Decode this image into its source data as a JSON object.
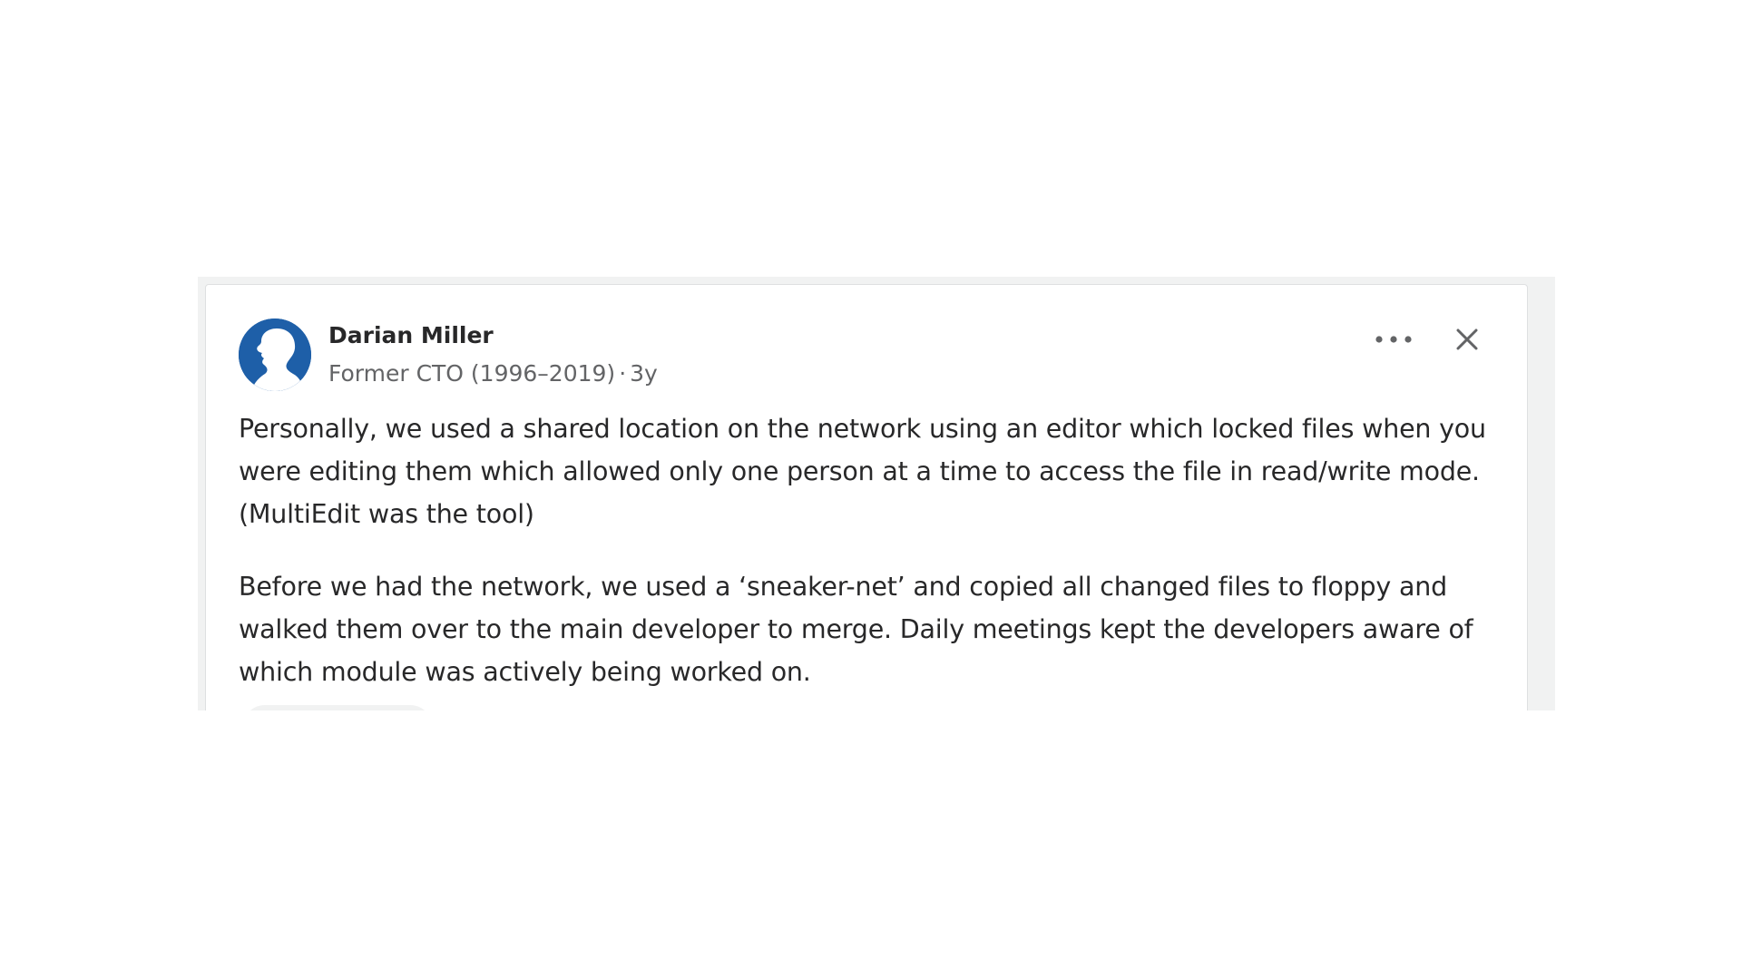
{
  "answer": {
    "author": {
      "name": "Darian Miller",
      "credential": "Former CTO (1996–2019)",
      "separator": "·",
      "timestamp": "3y"
    },
    "paragraphs": [
      "Personally, we used a shared location on the network using an editor which locked files when you were editing them which allowed only one person at a time to access the file in read/write mode. (MultiEdit was the tool)",
      "Before we had the network, we used a ‘sneaker-net’ and copied all changed files to floppy and walked them over to the main developer to merge. Daily meetings kept the developers aware of which module was actively being worked on."
    ]
  },
  "icons": {
    "avatar": "default-user-avatar-icon",
    "more": "more-options-icon",
    "close": "close-icon"
  },
  "colors": {
    "avatar_bg": "#1e5fa8",
    "text": "#282829",
    "secondary_text": "#636466",
    "icon": "#636466"
  }
}
